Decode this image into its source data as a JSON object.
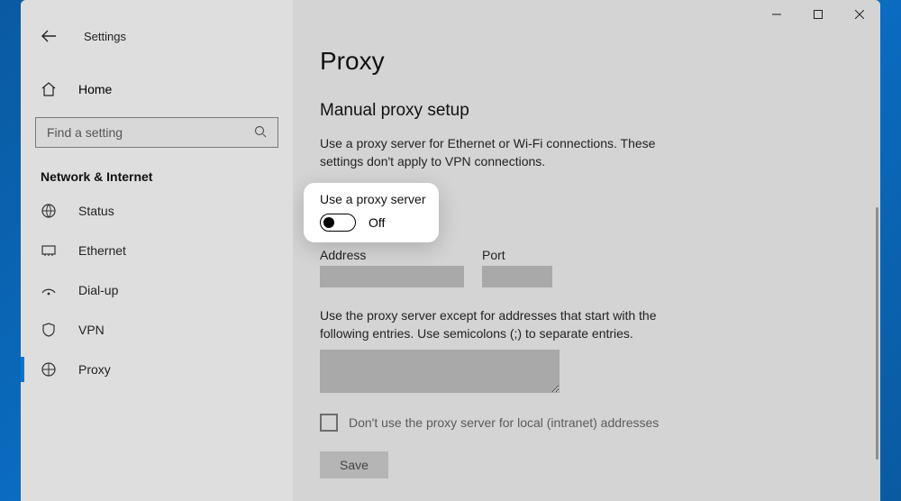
{
  "header": {
    "app_title": "Settings"
  },
  "sidebar": {
    "home_label": "Home",
    "search_placeholder": "Find a setting",
    "category": "Network & Internet",
    "items": [
      {
        "label": "Status"
      },
      {
        "label": "Ethernet"
      },
      {
        "label": "Dial-up"
      },
      {
        "label": "VPN"
      },
      {
        "label": "Proxy"
      }
    ]
  },
  "page": {
    "title": "Proxy",
    "section_title": "Manual proxy setup",
    "description": "Use a proxy server for Ethernet or Wi-Fi connections. These settings don't apply to VPN connections.",
    "toggle_title": "Use a proxy server",
    "toggle_state": "Off",
    "address_label": "Address",
    "port_label": "Port",
    "address_value": "",
    "port_value": "",
    "exceptions_label": "Use the proxy server except for addresses that start with the following entries. Use semicolons (;) to separate entries.",
    "exceptions_value": "",
    "bypass_local_label": "Don't use the proxy server for local (intranet) addresses",
    "save_label": "Save"
  }
}
